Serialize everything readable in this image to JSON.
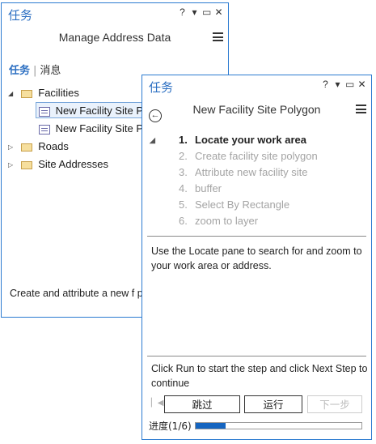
{
  "back_pane": {
    "title": "任务",
    "controls": {
      "help": "?",
      "dropdown": "▾",
      "restore": "▭",
      "close": "✕"
    },
    "header_title": "Manage Address Data",
    "tabs": [
      {
        "label": "任务",
        "active": true
      },
      {
        "label": "消息",
        "active": false
      }
    ],
    "tree": [
      {
        "label": "Facilities",
        "expanded": true,
        "children": [
          {
            "label": "New Facility Site Po",
            "selected": true
          },
          {
            "label": "New Facility Site Po",
            "selected": false
          }
        ]
      },
      {
        "label": "Roads",
        "expanded": false
      },
      {
        "label": "Site Addresses",
        "expanded": false
      }
    ],
    "description": "Create and attribute a new f polygon."
  },
  "front_pane": {
    "title": "任务",
    "controls": {
      "help": "?",
      "dropdown": "▾",
      "restore": "▭",
      "close": "✕"
    },
    "header_title": "New Facility Site Polygon",
    "steps": [
      {
        "num": "1.",
        "label": "Locate your work area",
        "active": true
      },
      {
        "num": "2.",
        "label": "Create facility site polygon",
        "active": false
      },
      {
        "num": "3.",
        "label": "Attribute new facility site",
        "active": false
      },
      {
        "num": "4.",
        "label": "buffer",
        "active": false
      },
      {
        "num": "5.",
        "label": "Select By Rectangle",
        "active": false
      },
      {
        "num": "6.",
        "label": "zoom to layer",
        "active": false
      }
    ],
    "step_description": "Use the Locate pane to search for and zoom to your work area or address.",
    "run_hint": "Click Run to start the step and click Next Step to continue",
    "buttons": {
      "skip": "跳过",
      "run": "运行",
      "next": "下一步"
    },
    "progress": {
      "label": "进度(1/6)",
      "fraction": 0.18
    }
  },
  "colors": {
    "accent": "#2c6fc2",
    "border": "#2c7bd1",
    "progress": "#1565c0"
  }
}
